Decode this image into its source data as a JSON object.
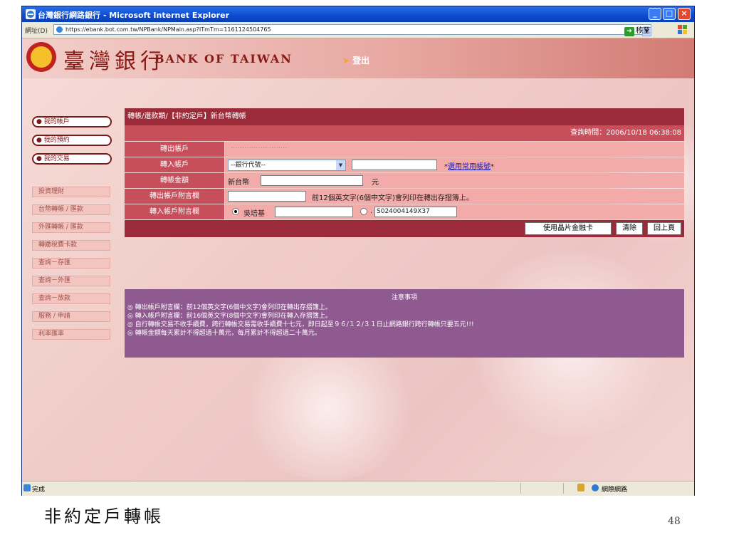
{
  "window": {
    "title": "台灣銀行網路銀行 - Microsoft Internet Explorer",
    "address_label": "網址(D)",
    "url": "https://ebank.bot.com.tw/NPBank/NPMain.asp?ITmTm=1161124504765",
    "go_label": "移至",
    "status_text": "完成",
    "zone_text": "網際網路"
  },
  "header": {
    "bank_name_cn": "臺灣銀行",
    "bank_name_en": "BANK OF TAIWAN",
    "logout": "登出"
  },
  "sidebar": {
    "top_items": [
      "我的帳戶",
      "我的預約",
      "我的交易"
    ],
    "sub_items": [
      "投資理財",
      "台幣轉帳 / 匯款",
      "外匯轉帳 / 匯款",
      "轉繳稅費卡款",
      "查詢－存匯",
      "查詢－外匯",
      "查詢－放款",
      "服務 / 申請",
      "利率匯率"
    ]
  },
  "form": {
    "breadcrumb": "轉帳/還款類/【非約定戶】新台幣轉帳",
    "query_time": "查詢時間：2006/10/18 06:38:08",
    "rows": {
      "from_account": {
        "label": "轉出帳戶",
        "value": "·························"
      },
      "to_account": {
        "label": "轉入帳戶",
        "bank_select": "--銀行代號--",
        "common_link": "選用常用帳號"
      },
      "amount": {
        "label": "轉帳金額",
        "currency": "新台幣",
        "unit": "元"
      },
      "out_memo": {
        "label": "轉出帳戶附言欄",
        "hint": "前12個英文字(6個中文字)會列印在轉出存摺簿上。"
      },
      "in_memo": {
        "label": "轉入帳戶附言欄",
        "option1": "吳培基",
        "option2_value": "S024004149X37"
      }
    },
    "buttons": {
      "chip_card": "使用晶片金融卡",
      "clear": "清除",
      "back": "回上頁"
    }
  },
  "notes": {
    "title": "注意事項",
    "lines": [
      "◎ 轉出帳戶附言欄：前12個英文字(6個中文字)會列印在轉出存摺簿上。",
      "◎ 轉入帳戶附言欄：前16個英文字(8個中文字)會列印在轉入存摺簿上。",
      "◎ 自行轉帳交易不收手續費，跨行轉帳交易需收手續費十七元，即日起至９６/１２/３１日止網路銀行跨行轉帳只要五元!!!",
      "◎ 轉帳金額每天累計不得超過十萬元，每月累計不得超過二十萬元。"
    ]
  },
  "slide": {
    "caption": "非約定戶轉帳",
    "page_number": "48"
  }
}
